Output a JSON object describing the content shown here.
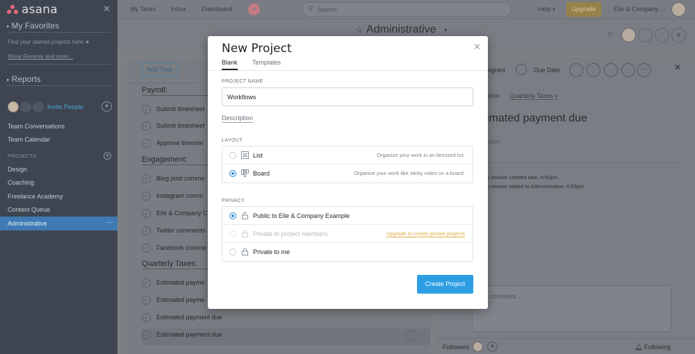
{
  "sidebar": {
    "brand": "asana",
    "my_favorites": "My Favorites",
    "favorites_hint": "Find your starred projects here",
    "show_recents": "Show Recents and more...",
    "reports": "Reports",
    "invite": "Invite People",
    "team_conversations": "Team Conversations",
    "team_calendar": "Team Calendar",
    "projects_header": "PROJECTS",
    "projects": [
      "Design",
      "Coaching",
      "Freelance Academy",
      "Content Queue",
      "Administrative"
    ],
    "active_dots": "···"
  },
  "topbar": {
    "nav": [
      "My Tasks",
      "Inbox",
      "Dashboard"
    ],
    "search_placeholder": "Search",
    "help": "Help",
    "upgrade": "Upgrade",
    "org": "Elle & Company ..."
  },
  "project": {
    "title": "Administrative"
  },
  "list": {
    "add_task": "Add Task",
    "sections": [
      {
        "name": "Payroll:",
        "tasks": [
          "Submit timesheet",
          "Submit timesheet",
          "Approve timeshe"
        ]
      },
      {
        "name": "Engagement:",
        "tasks": [
          "Blog post comme",
          "Instagram comm",
          "Elle & Company C",
          "Twitter comments",
          "Facebook comme"
        ]
      },
      {
        "name": "Quarterly Taxes:",
        "tasks": [
          "Estimated payme",
          "Estimated payme",
          "Estimated payment due",
          "Estimated payment due"
        ]
      }
    ]
  },
  "detail": {
    "assigned": "signed",
    "due_date": "Due Date",
    "tag_a": "ative",
    "tag_b": "Quarterly Taxes",
    "title": "imated payment due",
    "description": "ption",
    "activity": [
      "n Hooker created task.   4:50pm",
      "n Hooker added to Administrative.   4:50pm"
    ],
    "comment_placeholder": "e a comment...",
    "followers": "Followers",
    "following": "Following"
  },
  "modal": {
    "title": "New Project",
    "tabs": [
      "Blank",
      "Templates"
    ],
    "project_name_label": "PROJECT NAME",
    "project_name_value": "Workflows",
    "description_link": "Description",
    "layout_label": "LAYOUT",
    "layout_options": [
      {
        "label": "List",
        "hint": "Organize your work in an itemized list.",
        "selected": false,
        "icon": "list-icon"
      },
      {
        "label": "Board",
        "hint": "Organize your work like sticky notes on a board.",
        "selected": true,
        "icon": "board-icon"
      }
    ],
    "privacy_label": "PRIVACY",
    "privacy_options": [
      {
        "label": "Public to Elle & Company Example",
        "selected": true,
        "disabled": false
      },
      {
        "label": "Private to project members",
        "selected": false,
        "disabled": true,
        "upgrade_link": "Upgrade to create private projects"
      },
      {
        "label": "Private to me",
        "selected": false,
        "disabled": false
      }
    ],
    "create_button": "Create Project"
  },
  "colors": {
    "accent_blue": "#2d9ee4",
    "upgrade_gold": "#e0a93e",
    "sidebar_bg": "#3e4550",
    "active_item": "#3f7ab4"
  }
}
